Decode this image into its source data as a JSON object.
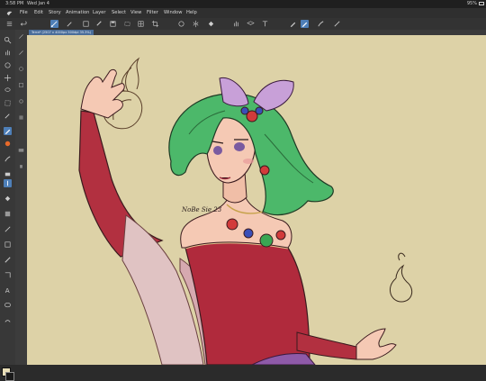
{
  "status_bar": {
    "time": "3:58 PM",
    "date": "Wed Jan 4",
    "battery": "95%"
  },
  "menu": [
    {
      "id": "file",
      "label": "File"
    },
    {
      "id": "edit",
      "label": "Edit"
    },
    {
      "id": "story",
      "label": "Story"
    },
    {
      "id": "animation",
      "label": "Animation"
    },
    {
      "id": "layer",
      "label": "Layer"
    },
    {
      "id": "select",
      "label": "Select"
    },
    {
      "id": "view",
      "label": "View"
    },
    {
      "id": "filter",
      "label": "Filter"
    },
    {
      "id": "window",
      "label": "Window"
    },
    {
      "id": "help",
      "label": "Help"
    }
  ],
  "document_tab": {
    "label": "Terra* (2507 x 4000px 500dpi 35.3%)"
  },
  "canvas": {
    "signature_text": "NoBe Sie 23"
  },
  "colors": {
    "accent": "#4e7fb8",
    "canvas_bg": "#ddd2a7",
    "main_color": "#e9dfb8",
    "sub_color": "#1a1a1a"
  },
  "toolbar_icons": [
    "menu-icon",
    "undo-icon",
    "redo-icon",
    "snap-icon",
    "transform-icon",
    "save-icon",
    "hand-icon",
    "rotate-icon",
    "flip-icon",
    "fill-icon",
    "ruler-icon",
    "pen-icon",
    "pen-active-icon",
    "brush-icon"
  ],
  "palette_icons": [
    "zoom-icon",
    "hand-icon",
    "rotate-icon",
    "move-icon",
    "lasso-icon",
    "selection-icon",
    "eyedropper-icon",
    "pen-icon",
    "brush-icon",
    "eraser-icon",
    "fill-icon",
    "gradient-icon",
    "shape-icon",
    "text-icon",
    "balloon-icon"
  ]
}
